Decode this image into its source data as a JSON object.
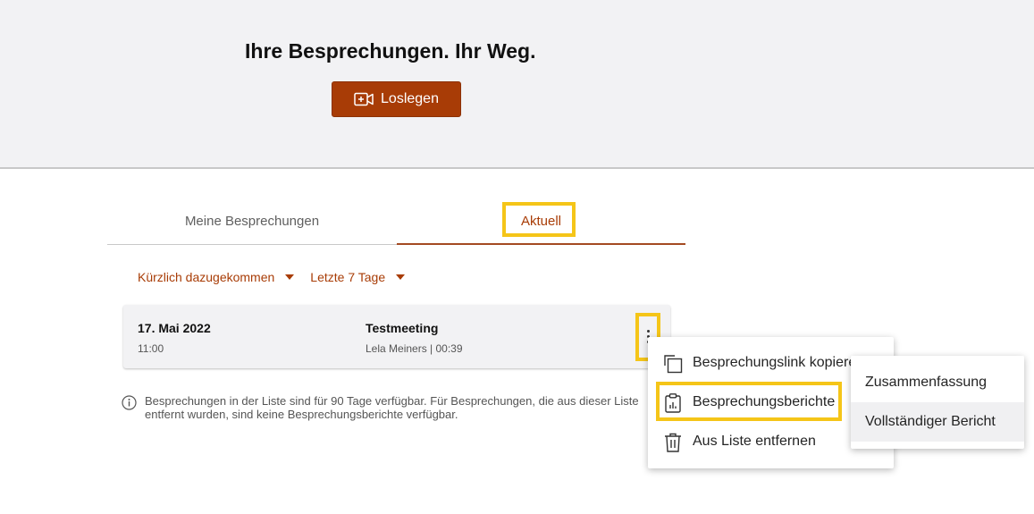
{
  "hero": {
    "title": "Ihre Besprechungen. Ihr Weg.",
    "start_button": "Loslegen",
    "start_icon": "video-add-icon",
    "accent_color": "#a83c06"
  },
  "tabs": [
    {
      "label": "Meine Besprechungen",
      "selected": false
    },
    {
      "label": "Aktuell",
      "selected": true
    }
  ],
  "filters": [
    {
      "label": "Kürzlich dazugekommen"
    },
    {
      "label": "Letzte 7 Tage"
    }
  ],
  "meeting": {
    "date": "17. Mai 2022",
    "time": "11:00",
    "title": "Testmeeting",
    "details": "Lela Meiners | 00:39"
  },
  "info_note": "Besprechungen in der Liste sind für 90 Tage verfügbar. Für Besprechungen, die aus dieser Liste entfernt wurden, sind keine Besprechungsberichte verfügbar.",
  "context_menu": {
    "items": [
      {
        "label": "Besprechungslink kopieren",
        "icon": "copy-icon"
      },
      {
        "label": "Besprechungsberichte",
        "icon": "clipboard-report-icon"
      },
      {
        "label": "Aus Liste entfernen",
        "icon": "trash-icon"
      }
    ]
  },
  "submenu": {
    "items": [
      {
        "label": "Zusammenfassung"
      },
      {
        "label": "Vollständiger Bericht"
      }
    ]
  },
  "highlight_color": "#f5c518"
}
